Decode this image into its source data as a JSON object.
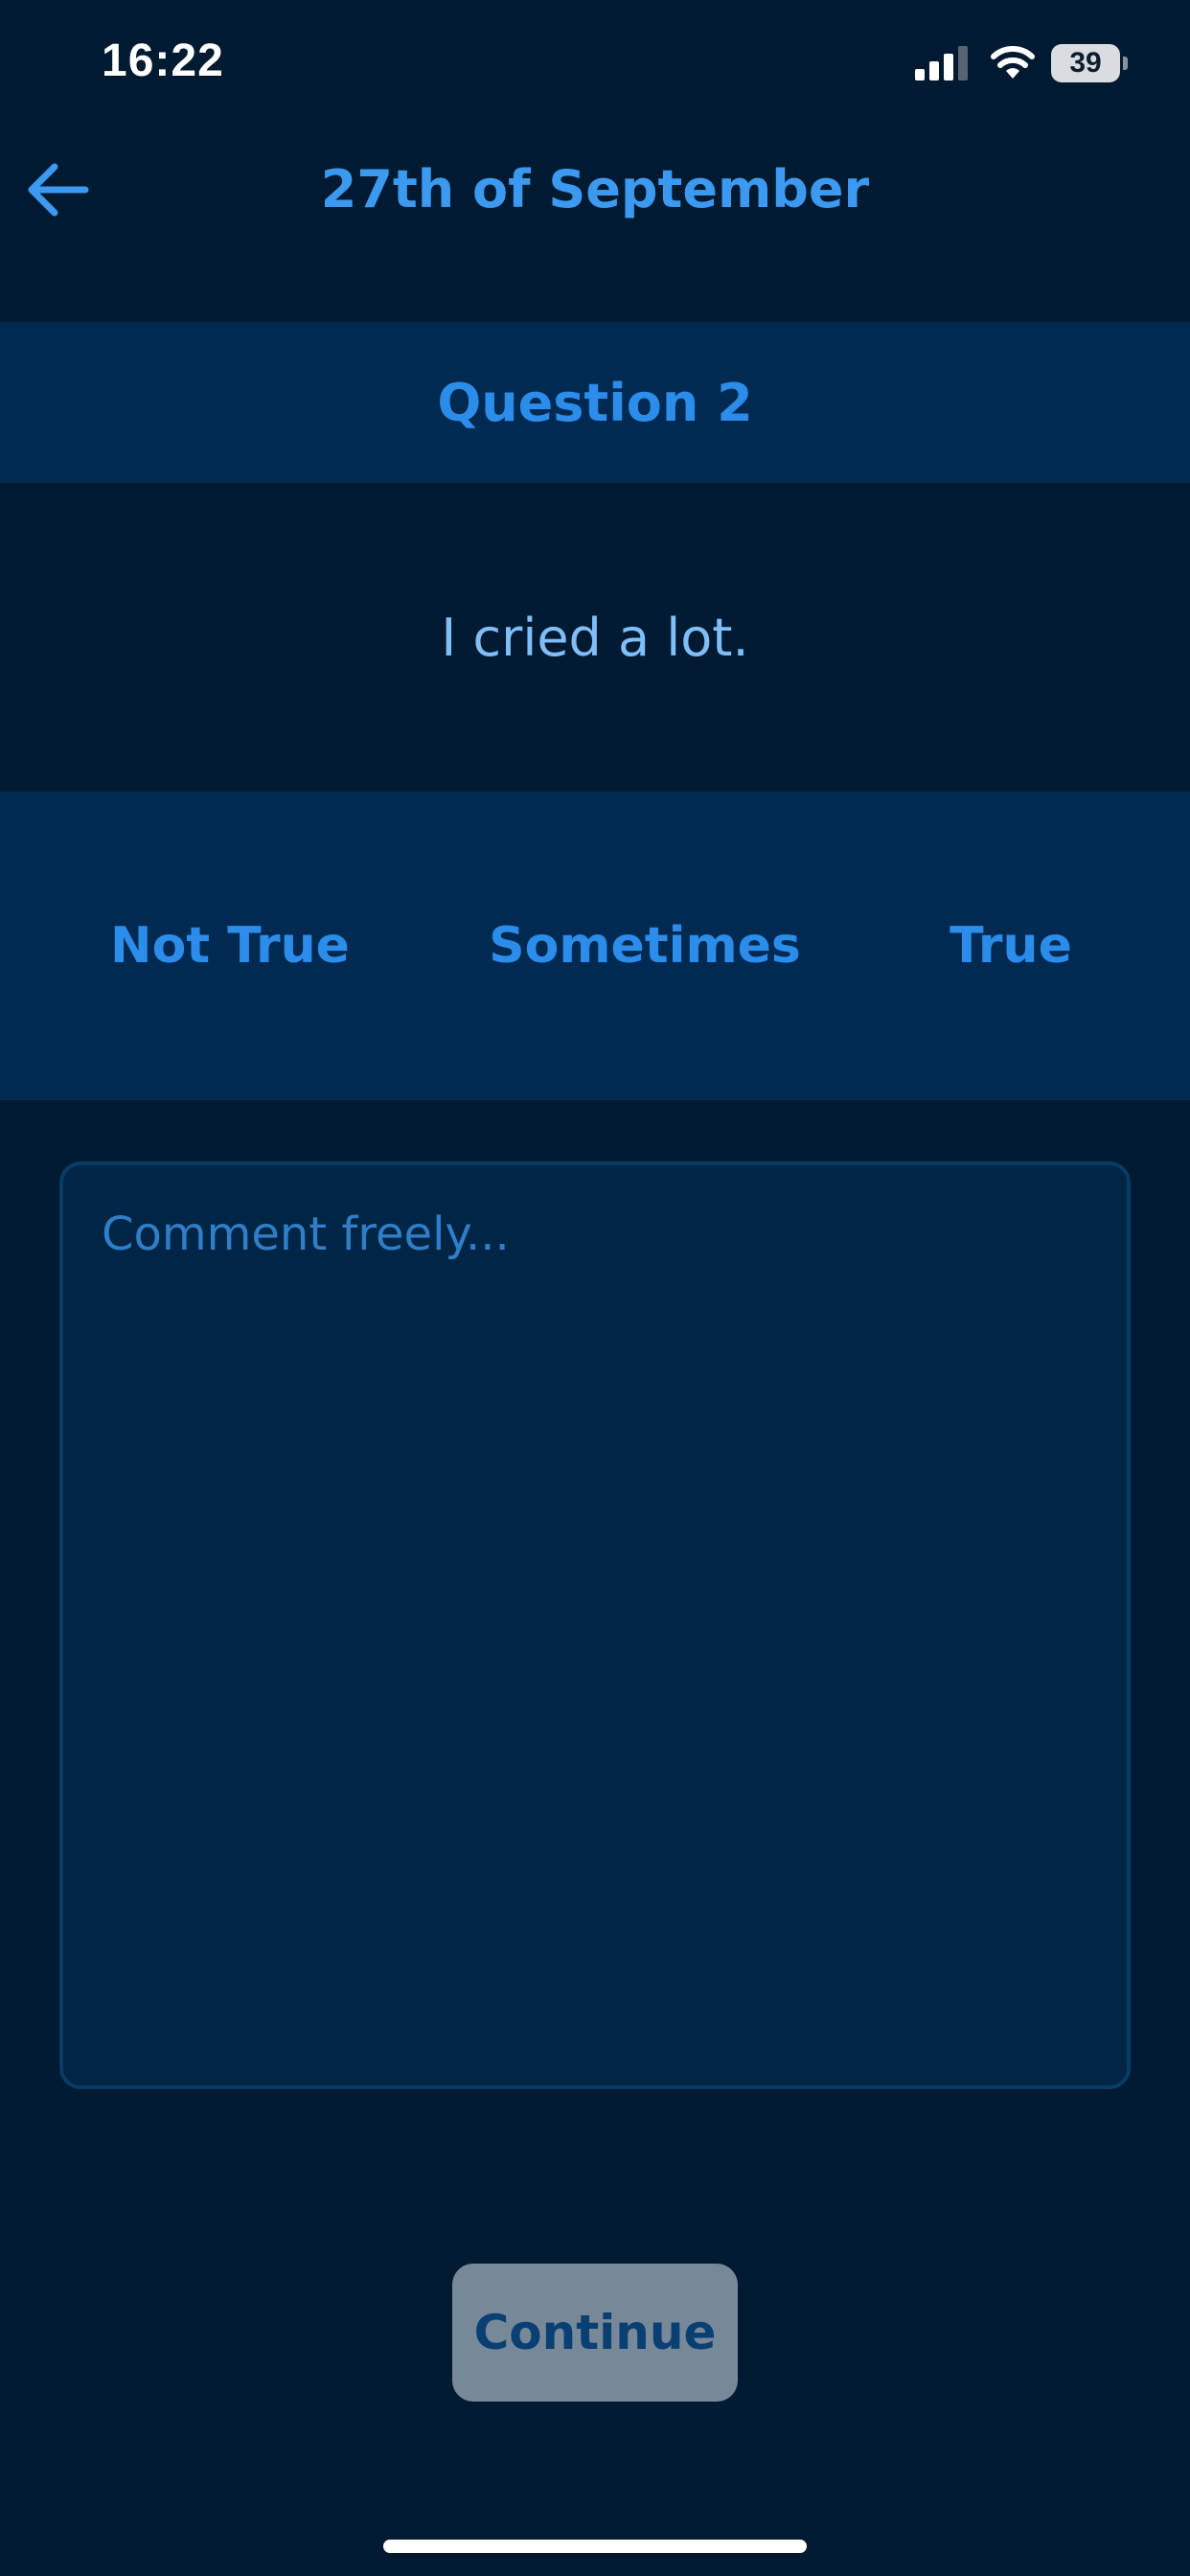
{
  "status_bar": {
    "time": "16:22",
    "battery_level": "39",
    "icons": [
      "signal-icon",
      "wifi-icon",
      "battery-icon"
    ]
  },
  "header": {
    "title": "27th of September",
    "back_icon": "arrow-left-icon"
  },
  "question": {
    "label": "Question 2",
    "statement": "I cried a lot."
  },
  "answers": [
    {
      "label": "Not True"
    },
    {
      "label": "Sometimes"
    },
    {
      "label": "True"
    }
  ],
  "comment": {
    "placeholder": "Comment freely...",
    "value": ""
  },
  "continue": {
    "label": "Continue"
  },
  "colors": {
    "background": "#001a31",
    "band": "#002a52",
    "accent": "#2b8de9",
    "button_disabled": "#778899"
  }
}
